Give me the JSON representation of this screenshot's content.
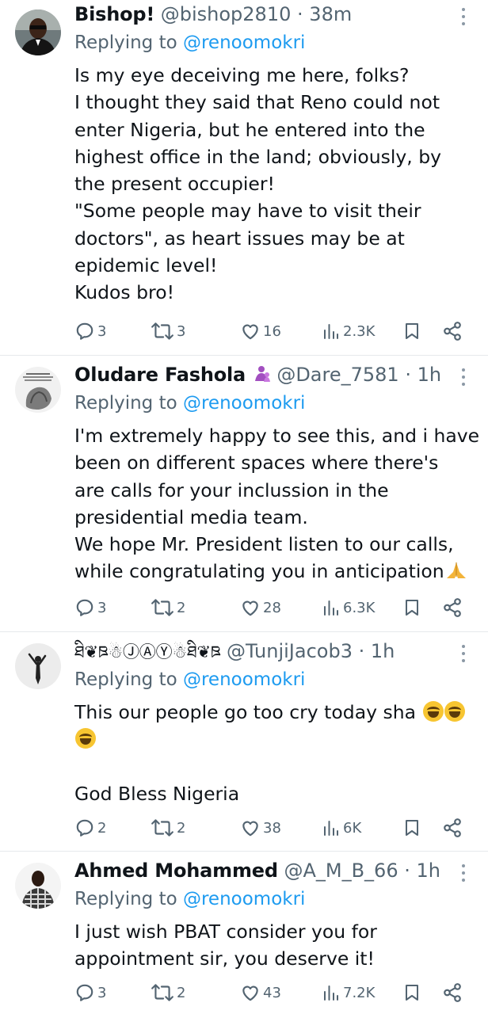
{
  "tweets": [
    {
      "name": "Bishop!",
      "badge": "",
      "handle": "@bishop2810",
      "dot": "·",
      "time": "38m",
      "replying_label": "Replying to",
      "replying_to": "@renoomokri",
      "lines": [
        "Is my eye deceiving me here, folks?",
        "I thought they said that Reno could not",
        "enter Nigeria, but he entered into the",
        "highest office in the land; obviously, by",
        "the present occupier!",
        "\"Some people may have to visit their",
        "doctors\", as heart issues may be at",
        "epidemic level!",
        "Kudos bro!"
      ],
      "replies": "3",
      "retweets": "3",
      "likes": "16",
      "views": "2.3K"
    },
    {
      "name": "Oludare Fashola",
      "badge": "👩‍👧",
      "handle": "@Dare_7581",
      "dot": "·",
      "time": "1h",
      "replying_label": "Replying to",
      "replying_to": "@renoomokri",
      "lines": [
        "I'm extremely happy to see this, and i have",
        "been on different spaces where there's",
        "are calls for your inclussion in the",
        "presidential media team.",
        "We hope Mr. President listen to our calls,",
        "while congratulating you in anticipation"
      ],
      "replies": "3",
      "retweets": "2",
      "likes": "28",
      "views": "6.3K"
    },
    {
      "name": "ཐི❦ཋ☃︎ⒿⒶⓎ☃︎ཐི❦ཋ",
      "badge": "",
      "handle": "@TunjiJacob3",
      "dot": "·",
      "time": "1h",
      "replying_label": "Replying to",
      "replying_to": "@renoomokri",
      "lines": [
        "This our people go too cry today sha",
        "",
        "",
        "God Bless Nigeria"
      ],
      "replies": "2",
      "retweets": "2",
      "likes": "38",
      "views": "6K"
    },
    {
      "name": "Ahmed Mohammed",
      "badge": "",
      "handle": "@A_M_B_66",
      "dot": "·",
      "time": "1h",
      "replying_label": "Replying to",
      "replying_to": "@renoomokri",
      "lines": [
        "I just wish PBAT consider you for",
        "appointment sir, you deserve it!"
      ],
      "replies": "3",
      "retweets": "2",
      "likes": "43",
      "views": "7.2K"
    }
  ],
  "colors": {
    "text": "#0f1419",
    "secondary": "#536471",
    "link": "#1d9bf0",
    "divider": "#e6e9ec"
  },
  "icons": [
    "reply-icon",
    "retweet-icon",
    "like-icon",
    "views-icon",
    "bookmark-icon",
    "share-icon",
    "more-icon"
  ]
}
